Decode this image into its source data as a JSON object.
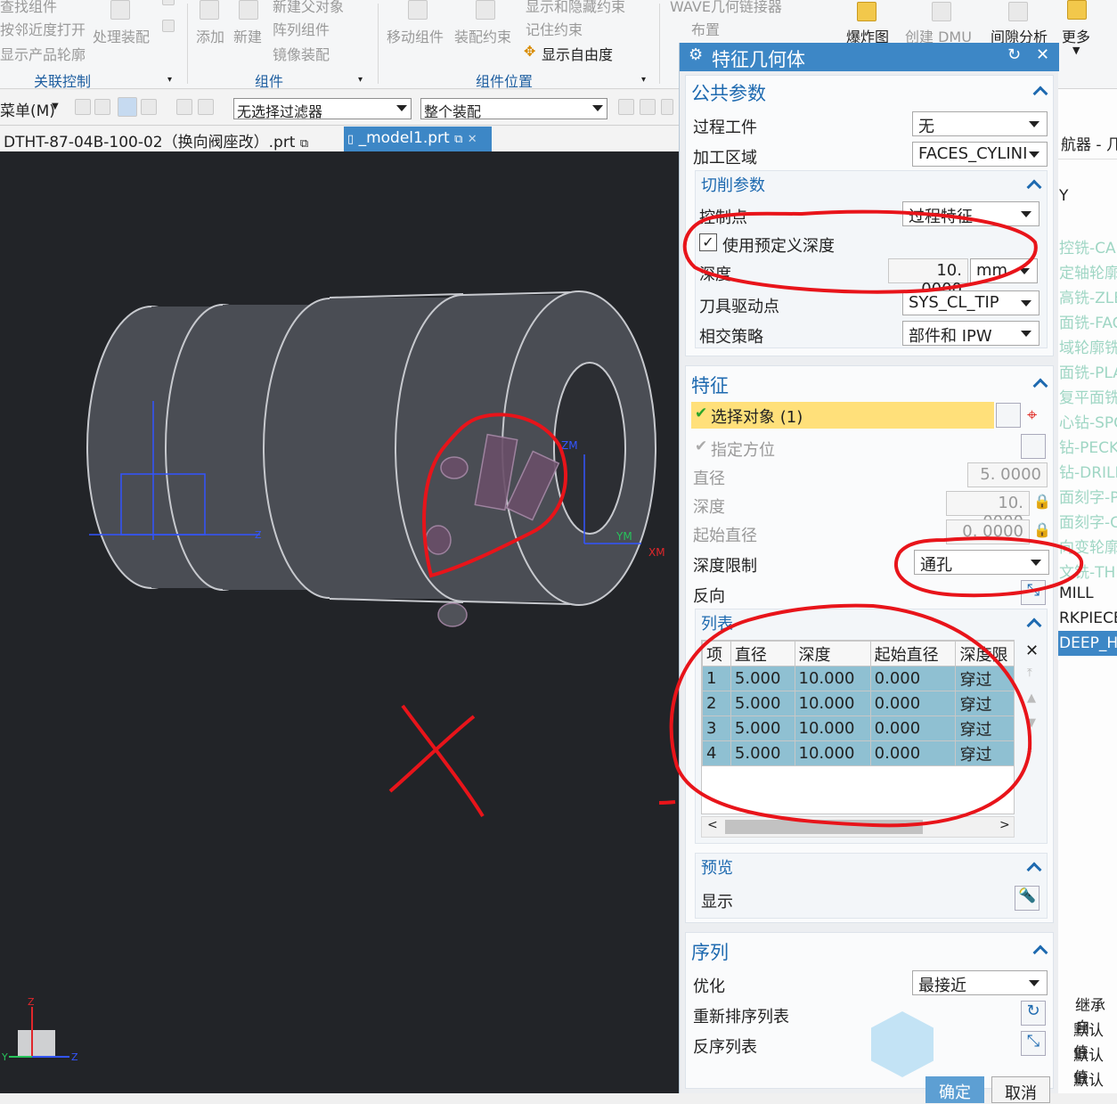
{
  "ribbon": {
    "top_items": [
      "查找组件",
      "WAVE几何链接器"
    ],
    "items_row1": [
      "按邻近度打开",
      "新建父对象",
      "显示和隐藏约束"
    ],
    "items_row2": [
      "显示产品轮廓",
      "阵列组件",
      "记住约束",
      "布置"
    ],
    "items_row3": [
      "镜像装配",
      "显示自由度"
    ],
    "buttons": [
      "处理装配",
      "添加",
      "新建",
      "移动组件",
      "装配约束",
      "爆炸图",
      "创建 DMU",
      "间隙分析",
      "更多"
    ],
    "groups": [
      "关联控制",
      "组件",
      "组件位置"
    ]
  },
  "toolbar": {
    "menu_label": "菜单(M)",
    "filter_value": "无选择过滤器",
    "scope_value": "整个装配"
  },
  "tabs": [
    {
      "label": "DTHT-87-04B-100-02（换向阀座改）.prt",
      "active": false
    },
    {
      "label": "_model1.prt",
      "active": true
    }
  ],
  "viewport": {
    "axis_labels": [
      "ZM",
      "YM",
      "XM",
      "Z"
    ],
    "triad_labels": [
      "Z",
      "Y",
      "Z"
    ]
  },
  "nav_strip": {
    "header": "航器 - 几何",
    "items": [
      "Y",
      "控铣-CA",
      "定轴轮廓",
      "高铣-ZLE",
      "面铣-FAC",
      "域轮廓铣",
      "面铣-PLA",
      "复平面铣",
      "心钻-SPC",
      "钻-PECK",
      "钻-DRILL",
      "面刻字-P",
      "面刻字-C",
      "向变轮廓",
      "文铣-TH",
      "MILL",
      "RKPIECE",
      "DEEP_H"
    ],
    "bottom_header": "继承自",
    "bottom_items": [
      "默认值",
      "默认值",
      "默认值"
    ]
  },
  "dialog": {
    "title": "特征几何体",
    "common": {
      "header": "公共参数",
      "process_workpiece_label": "过程工件",
      "process_workpiece_value": "无",
      "machining_area_label": "加工区域",
      "machining_area_value": "FACES_CYLINI"
    },
    "cut": {
      "header": "切削参数",
      "control_point_label": "控制点",
      "control_point_value": "过程特征",
      "use_predefined_depth_label": "使用预定义深度",
      "use_predefined_depth_checked": true,
      "depth_label": "深度",
      "depth_value": "10. 0000",
      "depth_unit": "mm",
      "tool_drive_label": "刀具驱动点",
      "tool_drive_value": "SYS_CL_TIP",
      "intersect_label": "相交策略",
      "intersect_value": "部件和 IPW"
    },
    "feature": {
      "header": "特征",
      "select_object": "选择对象 (1)",
      "specify_orientation": "指定方位",
      "diameter_label": "直径",
      "diameter_value": "5. 0000",
      "depth_label": "深度",
      "depth_value": "10. 0000",
      "start_diameter_label": "起始直径",
      "start_diameter_value": "0. 0000",
      "depth_limit_label": "深度限制",
      "depth_limit_value": "通孔",
      "reverse_label": "反向"
    },
    "list": {
      "header": "列表",
      "columns": [
        "项",
        "直径",
        "深度",
        "起始直径",
        "深度限"
      ],
      "rows": [
        [
          "1",
          "5.000",
          "10.000",
          "0.000",
          "穿过"
        ],
        [
          "2",
          "5.000",
          "10.000",
          "0.000",
          "穿过"
        ],
        [
          "3",
          "5.000",
          "10.000",
          "0.000",
          "穿过"
        ],
        [
          "4",
          "5.000",
          "10.000",
          "0.000",
          "穿过"
        ]
      ]
    },
    "preview": {
      "header": "预览",
      "display_label": "显示"
    },
    "sequence": {
      "header": "序列",
      "optimize_label": "优化",
      "optimize_value": "最接近",
      "reorder_label": "重新排序列表",
      "reverse_label": "反序列表"
    },
    "ok": "确定",
    "cancel": "取消"
  },
  "colors": {
    "title_bar": "#3d87c6",
    "selected_row": "#8fc0d2",
    "annotation": "#e8141a",
    "highlight": "#ffe07a"
  }
}
